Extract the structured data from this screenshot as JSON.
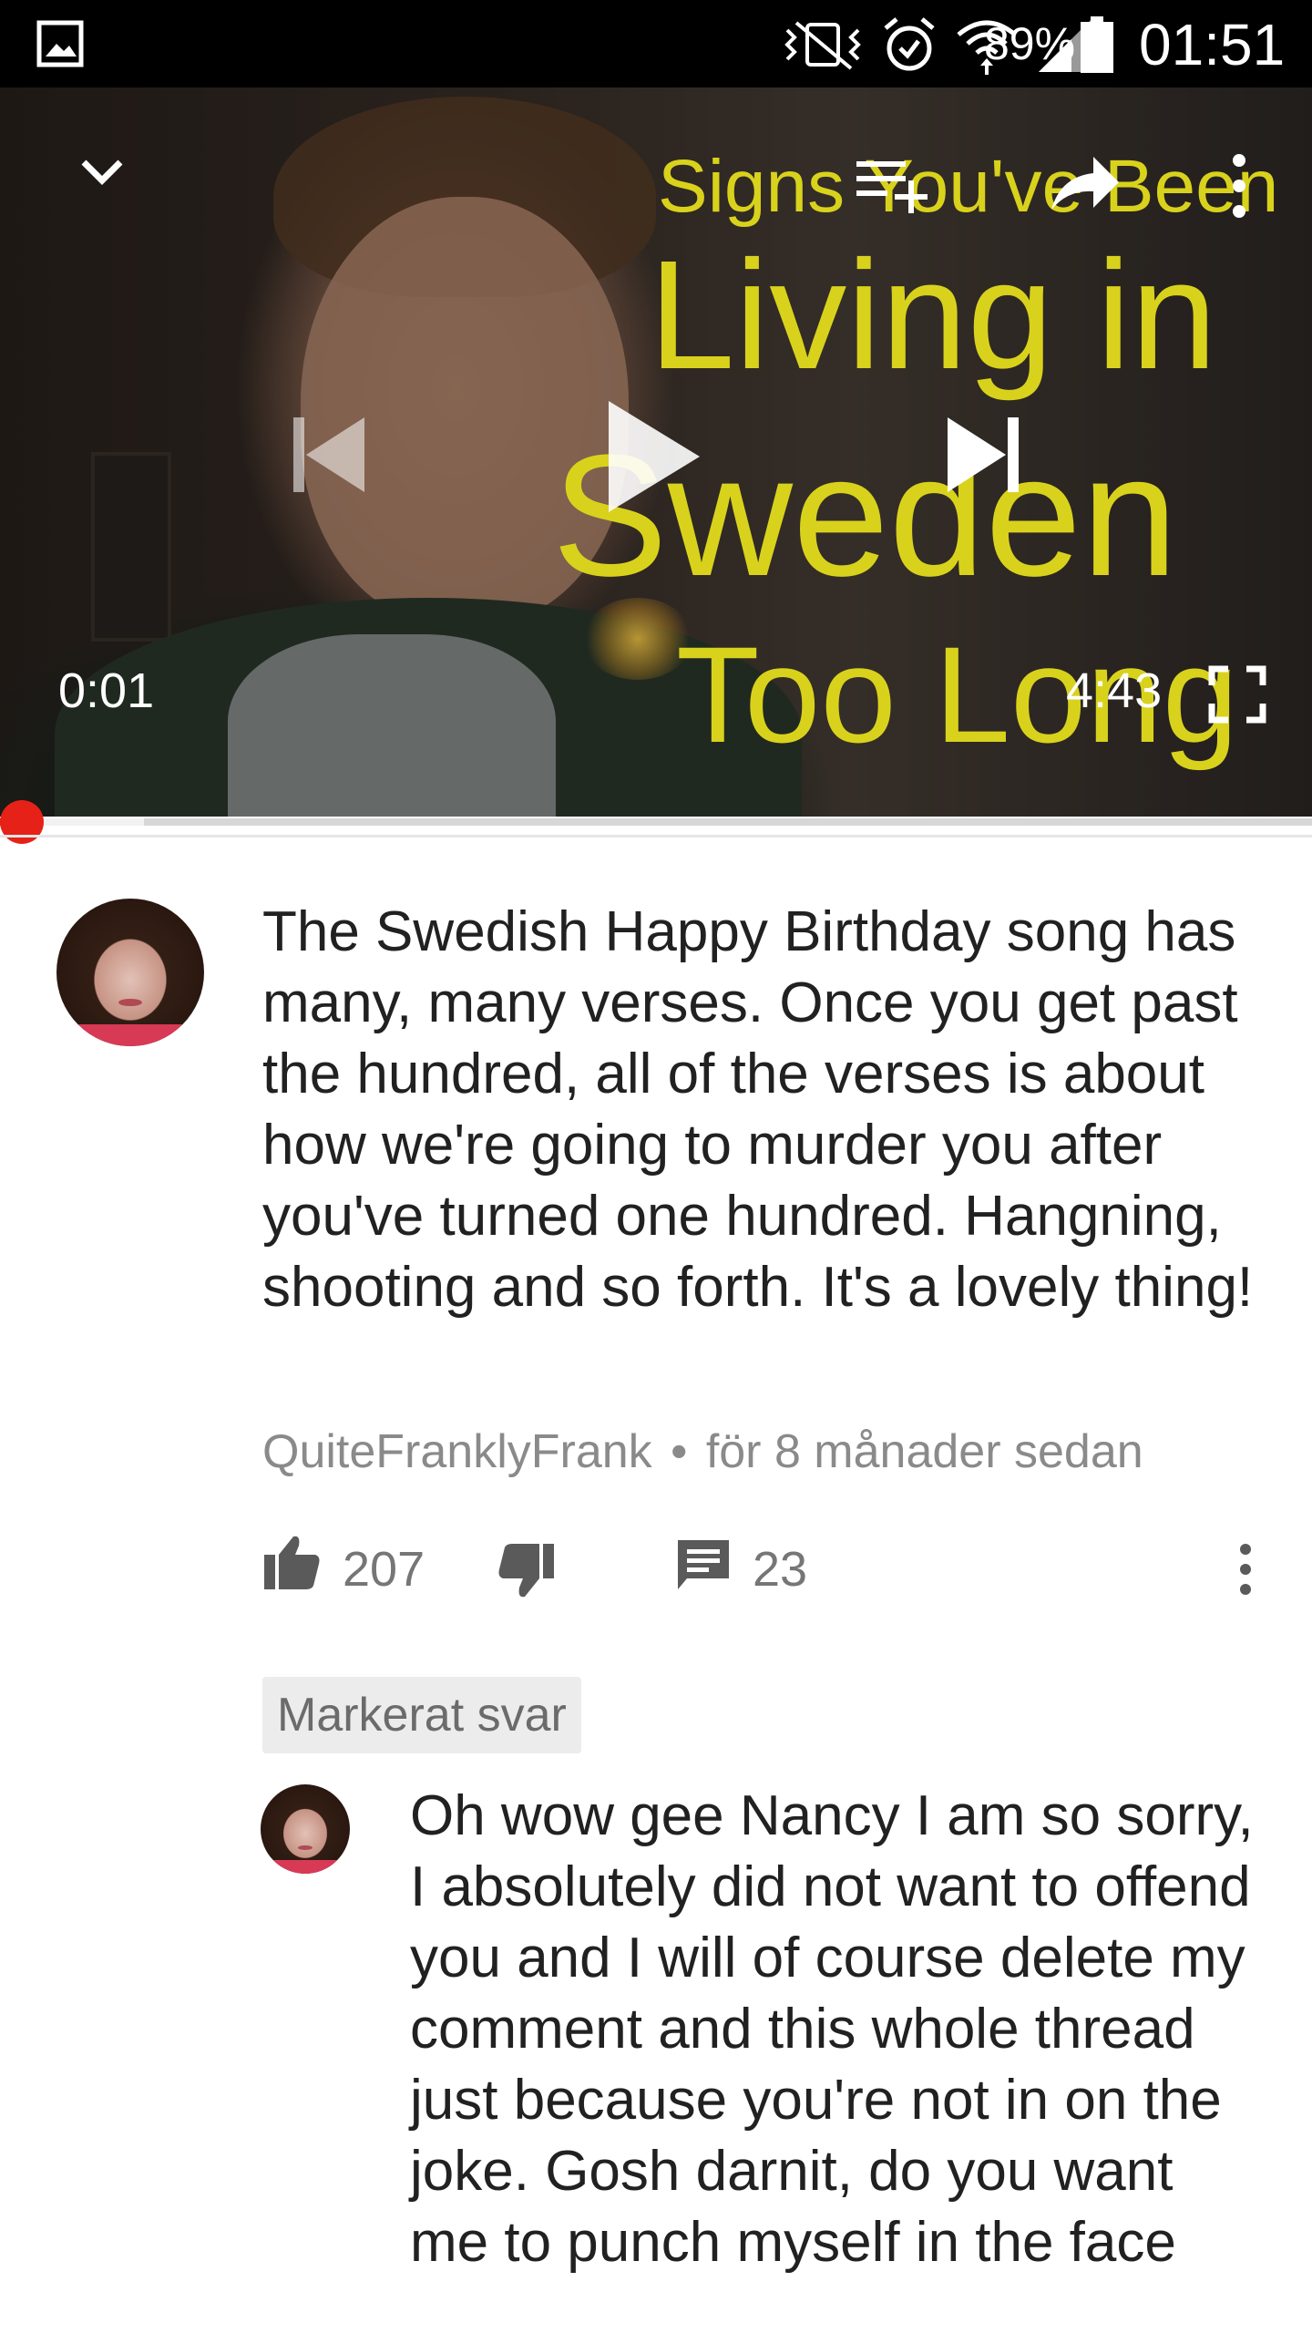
{
  "status_bar": {
    "battery_percent": "89%",
    "time": "01:51",
    "icons": [
      "gallery-icon",
      "vibrate-icon",
      "alarm-icon",
      "wifi-icon",
      "signal-icon",
      "battery-icon"
    ]
  },
  "player": {
    "overlay_title": {
      "line1": "Signs You've Been",
      "line2": "Living in",
      "line3": "Sweden",
      "line4": "Too Long"
    },
    "current_time": "0:01",
    "duration": "4:43",
    "progress_fraction": 0.004,
    "buffer_fraction": 0.11,
    "accent_color": "#e62117",
    "title_color": "#d9d21c",
    "controls": [
      "collapse-icon",
      "add-to-playlist-icon",
      "share-icon",
      "more-vert-icon",
      "previous-icon",
      "play-icon",
      "next-icon",
      "fullscreen-icon"
    ]
  },
  "comment": {
    "text": "The Swedish Happy Birthday song has many, many verses. Once you get past the hundred, all of the verses is about how we're going to murder you after you've turned one hundred. Hangning, shooting and so forth. It's a lovely thing!",
    "author": "QuiteFranklyFrank",
    "separator": "•",
    "time_ago": "för 8 månader sedan",
    "likes": "207",
    "replies": "23"
  },
  "highlighted_reply": {
    "badge": "Markerat svar",
    "text": "Oh wow gee Nancy I am so sorry, I absolutely did not want to offend you and I will of course delete my comment and this whole thread just because you're not in on the joke. Gosh darnit, do you want me to punch myself in the face"
  }
}
